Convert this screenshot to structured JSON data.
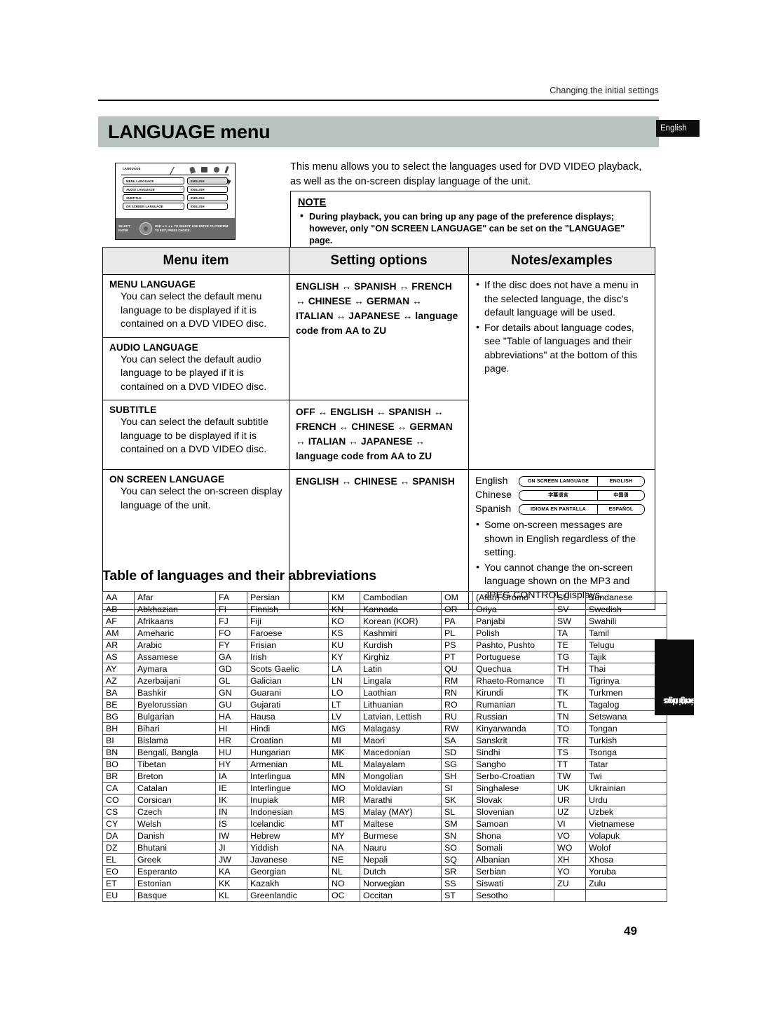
{
  "header": {
    "running_title": "Changing the initial settings",
    "page_title": "LANGUAGE menu",
    "language_tab": "English",
    "page_number": "49"
  },
  "side_tab": {
    "line1": "Changing the",
    "line2": "initial settings"
  },
  "osd_illustration": {
    "tab_name": "LANGUAGE",
    "icons": [
      "microphone-icon",
      "screen-icon",
      "disc-icon",
      "pen-icon"
    ],
    "rows": [
      {
        "label": "MENU LANGUAGE",
        "value": "ENGLISH",
        "selected": true
      },
      {
        "label": "AUDIO LANGUAGE",
        "value": "ENGLISH",
        "selected": false
      },
      {
        "label": "SUBTITLE",
        "value": "ENGLISH",
        "selected": false
      },
      {
        "label": "ON SCREEN LANGUAGE",
        "value": "ENGLISH",
        "selected": false
      }
    ],
    "footer_left_line1": "SELECT",
    "footer_left_line2": "ENTER",
    "footer_right_line1": "USE ▲▼◄► TO SELECT, USE ENTER TO CONFIRM",
    "footer_right_line2": "TO EXIT, PRESS CHOICE."
  },
  "intro": {
    "text": "This menu allows you to select the languages used for DVD VIDEO playback, as well as the on-screen display language of the unit."
  },
  "note": {
    "title": "NOTE",
    "items": [
      "During playback, you can bring up any page of the preference displays; however, only \"ON SCREEN LANGUAGE\" can be set on the \"LANGUAGE\" page."
    ]
  },
  "spec_table": {
    "headers": [
      "Menu item",
      "Setting options",
      "Notes/examples"
    ],
    "rows": [
      {
        "item_title": "MENU LANGUAGE",
        "item_desc": "You can select the default menu language to be displayed if it is contained on a DVD VIDEO disc.",
        "options": "ENGLISH ↔ SPANISH ↔ FRENCH ↔ CHINESE ↔ GERMAN ↔ ITALIAN ↔ JAPANESE ↔ language code from AA to ZU"
      },
      {
        "item_title": "AUDIO LANGUAGE",
        "item_desc": "You can select the default audio language to be played if it is contained on a DVD VIDEO disc.",
        "options": ""
      },
      {
        "item_title": "SUBTITLE",
        "item_desc": "You can select the default subtitle language to be displayed if it is contained on a DVD VIDEO disc.",
        "options": "OFF ↔ ENGLISH ↔ SPANISH ↔ FRENCH ↔ CHINESE ↔ GERMAN ↔ ITALIAN ↔ JAPANESE ↔ language code from AA to ZU"
      },
      {
        "item_title": "ON SCREEN LANGUAGE",
        "item_desc": "You can select the on-screen display language of the unit.",
        "options": "ENGLISH ↔ CHINESE ↔ SPANISH"
      }
    ],
    "notes_top": [
      "If the disc does not have a menu in the selected language, the disc's default language will be used.",
      "For details about language codes, see \"Table of languages and their abbreviations\" at the bottom of this page."
    ],
    "osd_examples": [
      {
        "name": "English",
        "left": "ON SCREEN LANGUAGE",
        "right": "ENGLISH"
      },
      {
        "name": "Chinese",
        "left": "字幕语言",
        "right": "中国语"
      },
      {
        "name": "Spanish",
        "left": "IDIOMA EN PANTALLA",
        "right": "ESPAÑOL"
      }
    ],
    "notes_bottom": [
      "Some on-screen messages are shown in English regardless of the setting.",
      "You cannot change the on-screen language shown on the MP3 and JPEG CONTROL displays."
    ]
  },
  "abbr_table": {
    "title": "Table of languages and their abbreviations",
    "rows": [
      [
        "AA",
        "Afar",
        "FA",
        "Persian",
        "KM",
        "Cambodian",
        "OM",
        "(Afan) Oromo",
        "SU",
        "Sundanese"
      ],
      [
        "AB",
        "Abkhazian",
        "FI",
        "Finnish",
        "KN",
        "Kannada",
        "OR",
        "Oriya",
        "SV",
        "Swedish"
      ],
      [
        "AF",
        "Afrikaans",
        "FJ",
        "Fiji",
        "KO",
        "Korean (KOR)",
        "PA",
        "Panjabi",
        "SW",
        "Swahili"
      ],
      [
        "AM",
        "Ameharic",
        "FO",
        "Faroese",
        "KS",
        "Kashmiri",
        "PL",
        "Polish",
        "TA",
        "Tamil"
      ],
      [
        "AR",
        "Arabic",
        "FY",
        "Frisian",
        "KU",
        "Kurdish",
        "PS",
        "Pashto, Pushto",
        "TE",
        "Telugu"
      ],
      [
        "AS",
        "Assamese",
        "GA",
        "Irish",
        "KY",
        "Kirghiz",
        "PT",
        "Portuguese",
        "TG",
        "Tajik"
      ],
      [
        "AY",
        "Aymara",
        "GD",
        "Scots Gaelic",
        "LA",
        "Latin",
        "QU",
        "Quechua",
        "TH",
        "Thai"
      ],
      [
        "AZ",
        "Azerbaijani",
        "GL",
        "Galician",
        "LN",
        "Lingala",
        "RM",
        "Rhaeto-Romance",
        "TI",
        "Tigrinya"
      ],
      [
        "BA",
        "Bashkir",
        "GN",
        "Guarani",
        "LO",
        "Laothian",
        "RN",
        "Kirundi",
        "TK",
        "Turkmen"
      ],
      [
        "BE",
        "Byelorussian",
        "GU",
        "Gujarati",
        "LT",
        "Lithuanian",
        "RO",
        "Rumanian",
        "TL",
        "Tagalog"
      ],
      [
        "BG",
        "Bulgarian",
        "HA",
        "Hausa",
        "LV",
        "Latvian, Lettish",
        "RU",
        "Russian",
        "TN",
        "Setswana"
      ],
      [
        "BH",
        "Bihari",
        "HI",
        "Hindi",
        "MG",
        "Malagasy",
        "RW",
        "Kinyarwanda",
        "TO",
        "Tongan"
      ],
      [
        "BI",
        "Bislama",
        "HR",
        "Croatian",
        "MI",
        "Maori",
        "SA",
        "Sanskrit",
        "TR",
        "Turkish"
      ],
      [
        "BN",
        "Bengali, Bangla",
        "HU",
        "Hungarian",
        "MK",
        "Macedonian",
        "SD",
        "Sindhi",
        "TS",
        "Tsonga"
      ],
      [
        "BO",
        "Tibetan",
        "HY",
        "Armenian",
        "ML",
        "Malayalam",
        "SG",
        "Sangho",
        "TT",
        "Tatar"
      ],
      [
        "BR",
        "Breton",
        "IA",
        "Interlingua",
        "MN",
        "Mongolian",
        "SH",
        "Serbo-Croatian",
        "TW",
        "Twi"
      ],
      [
        "CA",
        "Catalan",
        "IE",
        "Interlingue",
        "MO",
        "Moldavian",
        "SI",
        "Singhalese",
        "UK",
        "Ukrainian"
      ],
      [
        "CO",
        "Corsican",
        "IK",
        "Inupiak",
        "MR",
        "Marathi",
        "SK",
        "Slovak",
        "UR",
        "Urdu"
      ],
      [
        "CS",
        "Czech",
        "IN",
        "Indonesian",
        "MS",
        "Malay (MAY)",
        "SL",
        "Slovenian",
        "UZ",
        "Uzbek"
      ],
      [
        "CY",
        "Welsh",
        "IS",
        "Icelandic",
        "MT",
        "Maltese",
        "SM",
        "Samoan",
        "VI",
        "Vietnamese"
      ],
      [
        "DA",
        "Danish",
        "IW",
        "Hebrew",
        "MY",
        "Burmese",
        "SN",
        "Shona",
        "VO",
        "Volapuk"
      ],
      [
        "DZ",
        "Bhutani",
        "JI",
        "Yiddish",
        "NA",
        "Nauru",
        "SO",
        "Somali",
        "WO",
        "Wolof"
      ],
      [
        "EL",
        "Greek",
        "JW",
        "Javanese",
        "NE",
        "Nepali",
        "SQ",
        "Albanian",
        "XH",
        "Xhosa"
      ],
      [
        "EO",
        "Esperanto",
        "KA",
        "Georgian",
        "NL",
        "Dutch",
        "SR",
        "Serbian",
        "YO",
        "Yoruba"
      ],
      [
        "ET",
        "Estonian",
        "KK",
        "Kazakh",
        "NO",
        "Norwegian",
        "SS",
        "Siswati",
        "ZU",
        "Zulu"
      ],
      [
        "EU",
        "Basque",
        "KL",
        "Greenlandic",
        "OC",
        "Occitan",
        "ST",
        "Sesotho",
        "",
        ""
      ]
    ]
  }
}
